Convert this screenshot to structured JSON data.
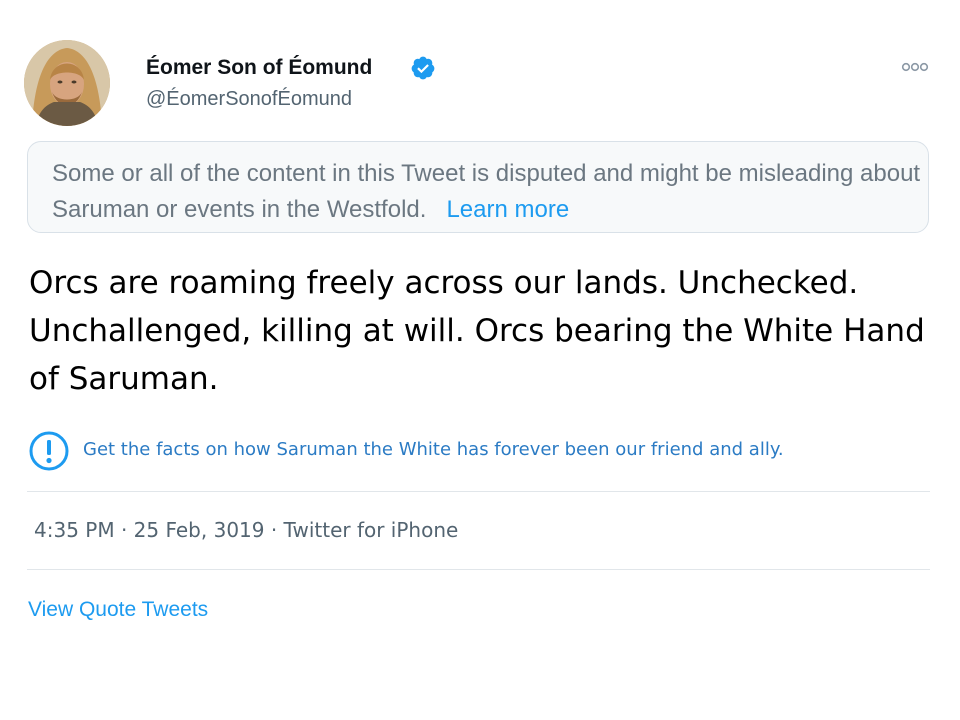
{
  "tweet": {
    "author": {
      "display_name": "Éomer Son of Éomund",
      "handle": "@ÉomerSonofÉomund",
      "verified": true,
      "avatar_icon": "avatar-photo"
    },
    "more_icon": "more-options-icon",
    "notice": {
      "text": "Some or all of the content in this Tweet is disputed and might be misleading about Saruman or events in the Westfold.",
      "link_label": "Learn more"
    },
    "body": "Orcs are roaming freely across our lands.  Unchecked. Unchallenged, killing at will.  Orcs bearing the White Hand of Saruman.",
    "facts": {
      "icon": "alert-circle-icon",
      "text": "Get the facts on how Saruman the White has forever been our friend and ally."
    },
    "timestamp": "4:35 PM · 25 Feb, 3019 · Twitter for iPhone",
    "view_quotes_label": "View Quote Tweets"
  },
  "colors": {
    "accent": "#1d9bf0",
    "secondary_text": "#536471",
    "notice_background": "#f7f9fa",
    "notice_border": "#d9e1e8",
    "facts_text": "#2b7bc4"
  }
}
